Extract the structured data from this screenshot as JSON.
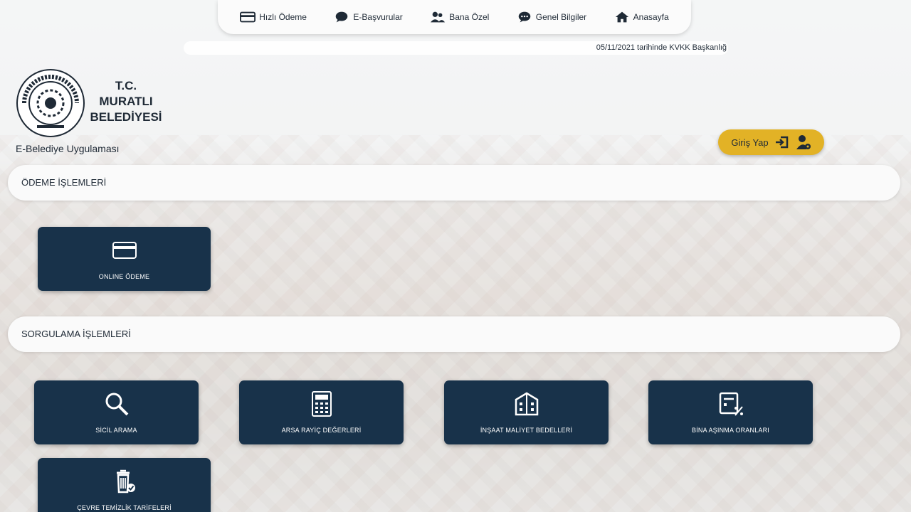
{
  "nav": {
    "items": [
      {
        "label": "Hızlı Ödeme",
        "icon": "credit-card-icon"
      },
      {
        "label": "E-Başvurular",
        "icon": "chat-bubble-icon"
      },
      {
        "label": "Bana Özel",
        "icon": "users-icon"
      },
      {
        "label": "Genel Bilgiler",
        "icon": "comment-icon"
      },
      {
        "label": "Anasayfa",
        "icon": "home-icon"
      }
    ]
  },
  "ticker": {
    "text": "05/11/2021 tarihinde KVKK Başkanlığ"
  },
  "header": {
    "logo_text": "MURATLI BELEDİYESİ 1941",
    "title_line1": "T.C.",
    "title_line2": "MURATLI",
    "title_line3": "BELEDİYESİ",
    "app_title": "E-Belediye Uygulaması"
  },
  "login": {
    "label": "Giriş Yap"
  },
  "sections": [
    {
      "title": "ÖDEME İŞLEMLERİ",
      "tiles": [
        {
          "label": "ONLINE ÖDEME",
          "icon": "card-icon"
        }
      ]
    },
    {
      "title": "SORGULAMA İŞLEMLERİ",
      "tiles": [
        {
          "label": "SİCİL ARAMA",
          "icon": "search-icon"
        },
        {
          "label": "ARSA RAYİÇ DEĞERLERİ",
          "icon": "calculator-icon"
        },
        {
          "label": "İNŞAAT MALİYET BEDELLERİ",
          "icon": "building-icon"
        },
        {
          "label": "BİNA AŞINMA ORANLARI",
          "icon": "percent-document-icon"
        },
        {
          "label": "ÇEVRE TEMİZLİK TARİFELERİ",
          "icon": "trash-icon"
        }
      ]
    }
  ],
  "colors": {
    "tile_bg": "#18324a",
    "login_bg": "#e2b226",
    "text_dark": "#1f2a36"
  }
}
